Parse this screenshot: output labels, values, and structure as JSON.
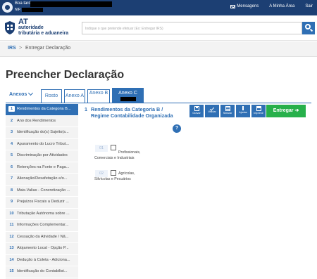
{
  "topbar": {
    "greeting": "Boa tarde,",
    "nif_label": "NIF:",
    "links": [
      "Mensagens",
      "A Minha Área",
      "Sair"
    ]
  },
  "header": {
    "logo_abbr": "AT",
    "logo_line1": "autoridade",
    "logo_line2": "tributária e aduaneira",
    "search_placeholder": "Indique o que pretende efetuar (Ex: Entregar IRS)"
  },
  "breadcrumb": {
    "root": "IRS",
    "separator": ">",
    "current": "Entregar Declaração"
  },
  "page_title": "Preencher Declaração",
  "tabs": {
    "anexos_label": "Anexos",
    "rosto": "Rosto",
    "anexo_a": "Anexo A",
    "anexo_b": "Anexo B",
    "anexo_c": "Anexo C"
  },
  "sidebar": {
    "items": [
      {
        "num": "1",
        "label": "Rendimentos da Categoria B..."
      },
      {
        "num": "2",
        "label": "Ano dos Rendimentos"
      },
      {
        "num": "3",
        "label": "Identificação do(s) Sujeito(s..."
      },
      {
        "num": "4",
        "label": "Apuramento do Lucro Tribut..."
      },
      {
        "num": "5",
        "label": "Discriminação por Atividades"
      },
      {
        "num": "6",
        "label": "Retenções na Fonte e Paga..."
      },
      {
        "num": "7",
        "label": "Alienação/Desafetação e/o..."
      },
      {
        "num": "8",
        "label": "Mais-Valias - Concretização ..."
      },
      {
        "num": "9",
        "label": "Prejuízos Fiscais a Deduzir ..."
      },
      {
        "num": "10",
        "label": "Tributação Autónoma sobre ..."
      },
      {
        "num": "11",
        "label": "Informações Complementar..."
      },
      {
        "num": "12",
        "label": "Cessação da Atividade / Nã..."
      },
      {
        "num": "13",
        "label": "Alojamento Local - Opção P..."
      },
      {
        "num": "14",
        "label": "Dedução à Coleta - Adiciona..."
      },
      {
        "num": "15",
        "label": "Identificação do Contabilist..."
      }
    ]
  },
  "content": {
    "section_num": "1",
    "section_title": "Rendimentos da Categoria B / Regime Contabilidade Organizada",
    "help": "?",
    "toolbar": [
      "Gravar",
      "Validar",
      "Simular",
      "Ajudas",
      "Imprimir"
    ],
    "submit": "Entregar",
    "options": [
      {
        "num": "01",
        "label": "Profissionais, Comerciais e Industriais"
      },
      {
        "num": "02",
        "label": "Agrícolas, Silvícolas e Pecuários"
      }
    ]
  },
  "colors": {
    "topbar": "#1c3f73",
    "primary": "#2f6fb4",
    "success": "#27b04b",
    "sidebar_bg": "#f3f3f3"
  }
}
